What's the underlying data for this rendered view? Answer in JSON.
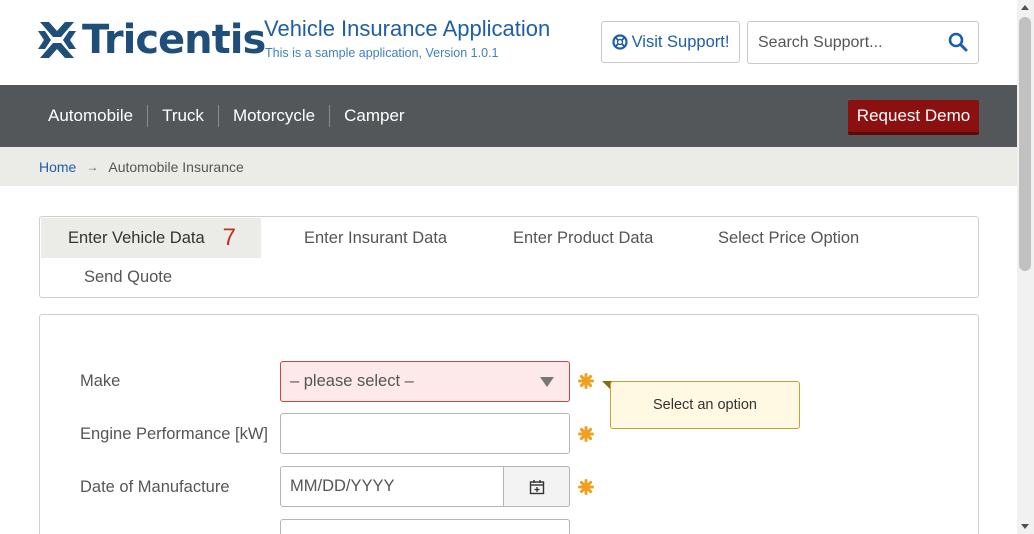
{
  "header": {
    "logo_text": "Tricentis",
    "app_title": "Vehicle Insurance Application",
    "app_subtitle": "This is a sample application, Version 1.0.1",
    "support_label": "Visit Support!",
    "search_placeholder": "Search Support..."
  },
  "nav": {
    "items": [
      {
        "label": "Automobile"
      },
      {
        "label": "Truck"
      },
      {
        "label": "Motorcycle"
      },
      {
        "label": "Camper"
      }
    ],
    "demo_label": "Request Demo"
  },
  "breadcrumb": {
    "home": "Home",
    "arrow": "→",
    "current": "Automobile Insurance"
  },
  "tabs": [
    {
      "label": "Enter Vehicle Data",
      "count": "7"
    },
    {
      "label": "Enter Insurant Data"
    },
    {
      "label": "Enter Product Data"
    },
    {
      "label": "Select Price Option"
    },
    {
      "label": "Send Quote"
    }
  ],
  "form": {
    "make_label": "Make",
    "make_value": "– please select –",
    "engine_label": "Engine Performance [kW]",
    "engine_value": "",
    "date_label": "Date of Manufacture",
    "date_placeholder": "MM/DD/YYYY",
    "tooltip": "Select an option"
  },
  "colors": {
    "brand_blue": "#1e4e79",
    "nav_bg": "#54575a",
    "demo_red": "#8b1111",
    "required_orange": "#f0a020",
    "error_bg": "#fde9e9"
  }
}
